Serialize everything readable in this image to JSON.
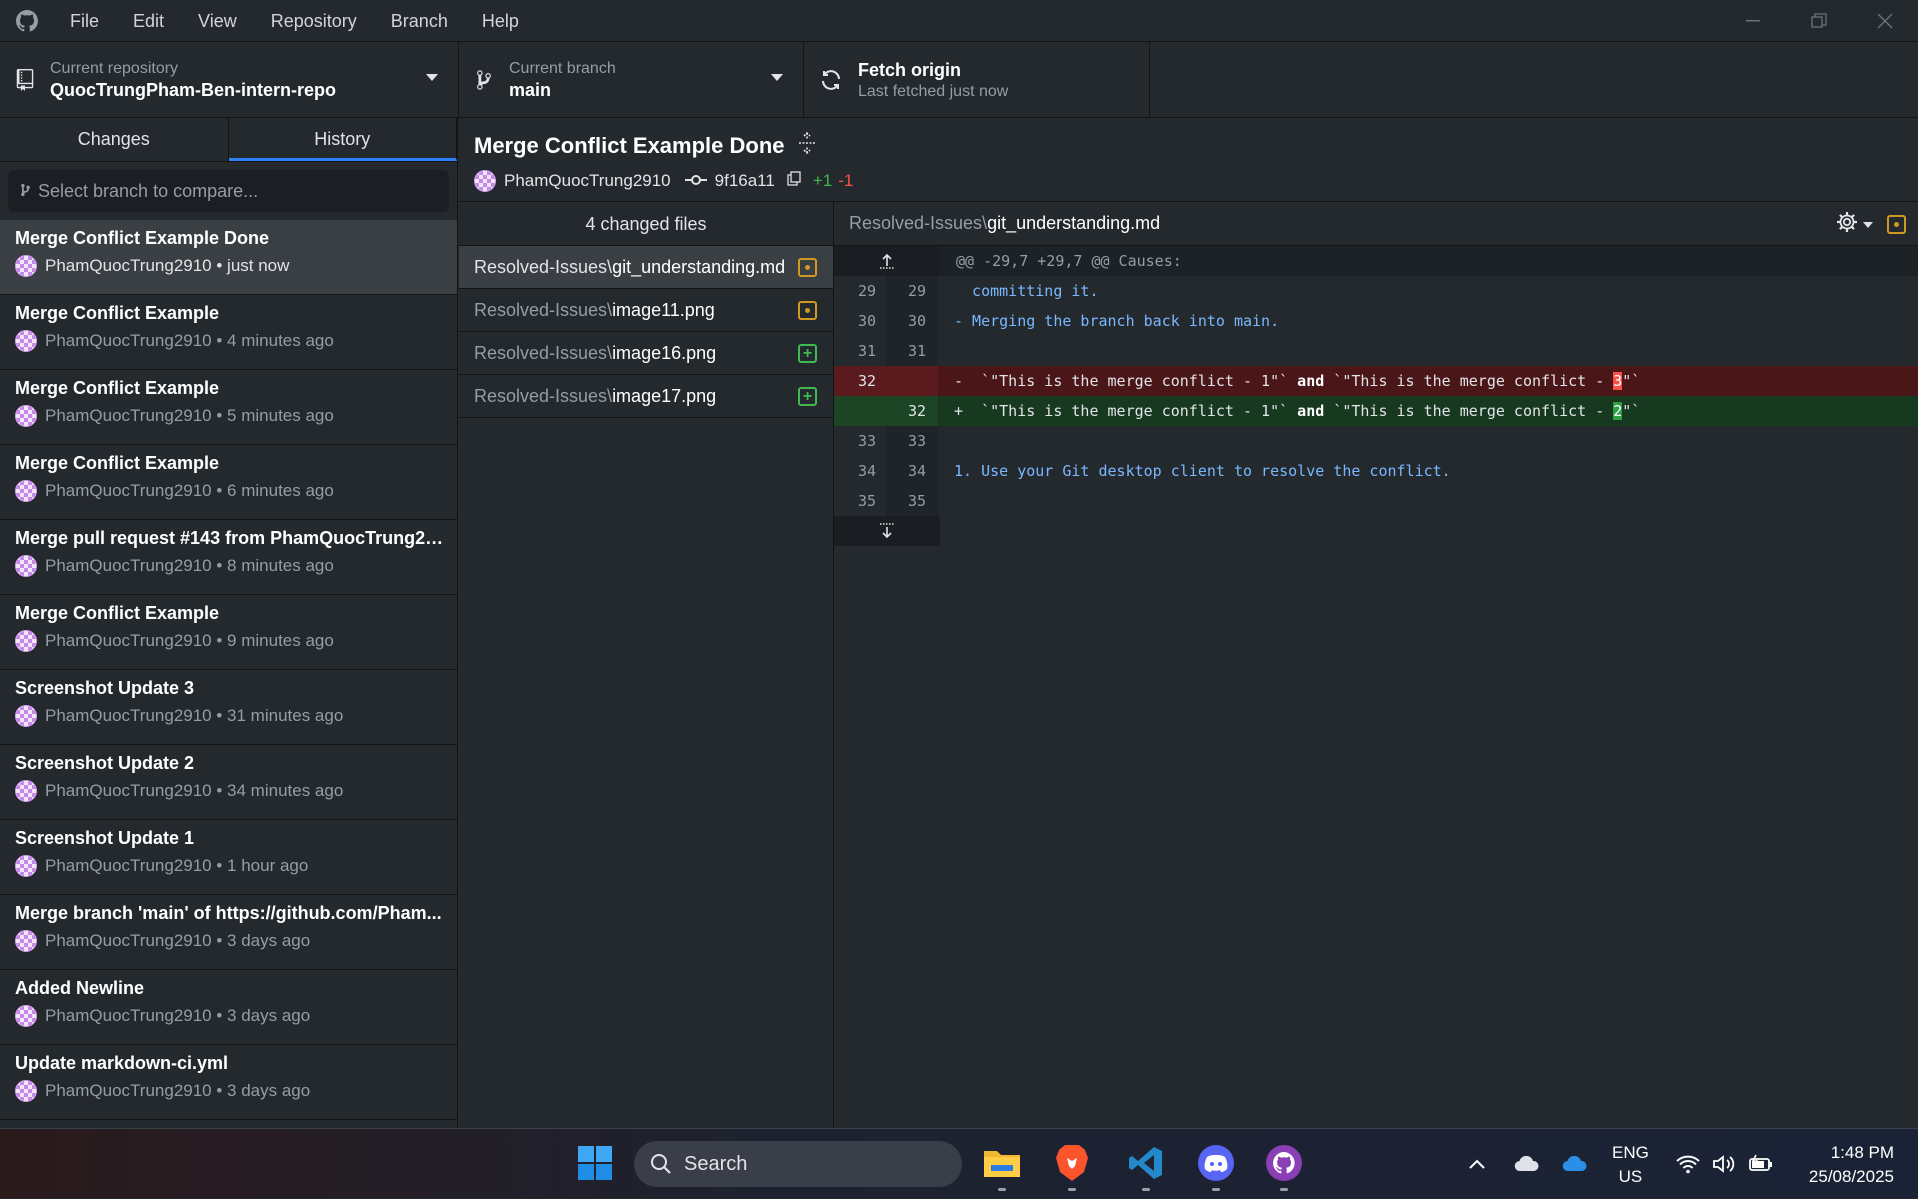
{
  "menu": [
    "File",
    "Edit",
    "View",
    "Repository",
    "Branch",
    "Help"
  ],
  "toolbar": {
    "repo_label": "Current repository",
    "repo_value": "QuocTrungPham-Ben-intern-repo",
    "branch_label": "Current branch",
    "branch_value": "main",
    "fetch_title": "Fetch origin",
    "fetch_sub": "Last fetched just now"
  },
  "sidebar": {
    "tabs": [
      "Changes",
      "History"
    ],
    "compare_placeholder": "Select branch to compare...",
    "commits": [
      {
        "title": "Merge Conflict Example Done",
        "author": "PhamQuocTrung2910",
        "time": "just now"
      },
      {
        "title": "Merge Conflict Example",
        "author": "PhamQuocTrung2910",
        "time": "4 minutes ago"
      },
      {
        "title": "Merge Conflict Example",
        "author": "PhamQuocTrung2910",
        "time": "5 minutes ago"
      },
      {
        "title": "Merge Conflict Example",
        "author": "PhamQuocTrung2910",
        "time": "6 minutes ago"
      },
      {
        "title": "Merge pull request #143 from PhamQuocTrung29...",
        "author": "PhamQuocTrung2910",
        "time": "8 minutes ago"
      },
      {
        "title": "Merge Conflict Example",
        "author": "PhamQuocTrung2910",
        "time": "9 minutes ago"
      },
      {
        "title": "Screenshot Update 3",
        "author": "PhamQuocTrung2910",
        "time": "31 minutes ago"
      },
      {
        "title": "Screenshot Update 2",
        "author": "PhamQuocTrung2910",
        "time": "34 minutes ago"
      },
      {
        "title": "Screenshot Update 1",
        "author": "PhamQuocTrung2910",
        "time": "1 hour ago"
      },
      {
        "title": "Merge branch 'main' of https://github.com/Pham...",
        "author": "PhamQuocTrung2910",
        "time": "3 days ago"
      },
      {
        "title": "Added Newline",
        "author": "PhamQuocTrung2910",
        "time": "3 days ago"
      },
      {
        "title": "Update markdown-ci.yml",
        "author": "PhamQuocTrung2910",
        "time": "3 days ago"
      }
    ]
  },
  "commit": {
    "title": "Merge Conflict Example Done",
    "author": "PhamQuocTrung2910",
    "sha": "9f16a11",
    "additions": "+1",
    "deletions": "-1"
  },
  "files": {
    "header": "4 changed files",
    "items": [
      {
        "dir": "Resolved-Issues\\",
        "name": "git_understanding.md",
        "status": "modified"
      },
      {
        "dir": "Resolved-Issues\\",
        "name": "image11.png",
        "status": "modified"
      },
      {
        "dir": "Resolved-Issues\\",
        "name": "image16.png",
        "status": "added"
      },
      {
        "dir": "Resolved-Issues\\",
        "name": "image17.png",
        "status": "added"
      }
    ]
  },
  "diff": {
    "path_dir": "Resolved-Issues\\",
    "path_name": "git_understanding.md",
    "hunk": "@@ -29,7 +29,7 @@ Causes:",
    "lines": [
      {
        "old": "29",
        "new": "29",
        "text": "  committing it."
      },
      {
        "old": "30",
        "new": "30",
        "text": "- Merging the branch back into main."
      },
      {
        "old": "31",
        "new": "31",
        "text": ""
      },
      {
        "old": "33",
        "new": "33",
        "text": ""
      },
      {
        "old": "34",
        "new": "34",
        "text": "1. Use your Git desktop client to resolve the conflict."
      },
      {
        "old": "35",
        "new": "35",
        "text": ""
      }
    ],
    "del": {
      "old": "32",
      "sign": "-",
      "pre": "`\"This is the merge conflict - 1\"` ",
      "kw": "and",
      "mid": " `\"This is the merge conflict - ",
      "hl": "3",
      "post": "\"`"
    },
    "add": {
      "new": "32",
      "sign": "+",
      "pre": "`\"This is the merge conflict - 1\"` ",
      "kw": "and",
      "mid": " `\"This is the merge conflict - ",
      "hl": "2",
      "post": "\"`"
    }
  },
  "taskbar": {
    "search": "Search",
    "lang1": "ENG",
    "lang2": "US",
    "time": "1:48 PM",
    "date": "25/08/2025"
  }
}
